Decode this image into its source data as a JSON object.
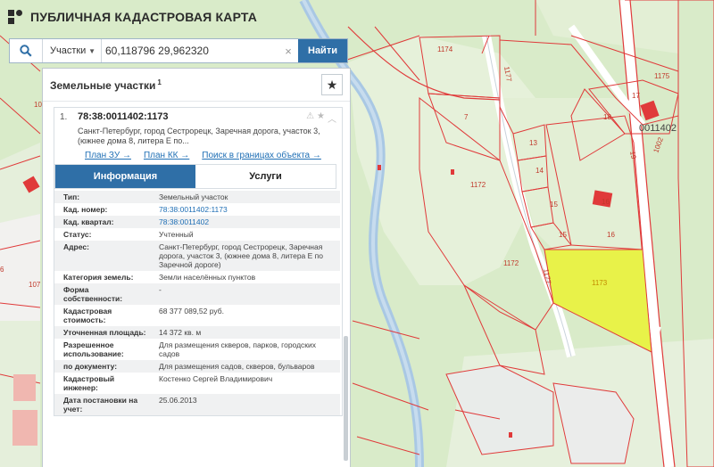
{
  "header": {
    "title": "ПУБЛИЧНАЯ КАДАСТРОВАЯ КАРТА"
  },
  "search": {
    "type_label": "Участки",
    "value": "60,118796 29,962320",
    "find_label": "Найти"
  },
  "panel": {
    "title": "Земельные участки",
    "title_sup": "1"
  },
  "result": {
    "index": "1.",
    "number": "78:38:0011402:1173",
    "address": "Санкт-Петербург, город Сестрорецк, Заречная дорога, участок 3, (южнее дома 8, литера Е по...",
    "links": [
      "План ЗУ →",
      "План КК →",
      "Поиск в границах объекта →"
    ]
  },
  "tabs": {
    "info": "Информация",
    "services": "Услуги"
  },
  "info_rows": [
    {
      "key": "Тип:",
      "value": "Земельный участок"
    },
    {
      "key": "Кад. номер:",
      "value": "78:38:0011402:1173"
    },
    {
      "key": "Кад. квартал:",
      "value": "78:38:0011402"
    },
    {
      "key": "Статус:",
      "value": "Учтенный"
    },
    {
      "key": "Адрес:",
      "value": "Санкт-Петербург, город Сестрорецк, Заречная дорога, участок 3, (южнее дома 8, литера Е по Заречной дороге)"
    },
    {
      "key": "Категория земель:",
      "value": "Земли населённых пунктов"
    },
    {
      "key": "Форма собственности:",
      "value": "-"
    },
    {
      "key": "Кадастровая стоимость:",
      "value": "68 377 089,52 руб."
    },
    {
      "key": "Уточненная площадь:",
      "value": "14 372 кв. м"
    },
    {
      "key": "Разрешенное использование:",
      "value": "Для размещения скверов, парков, городских садов"
    },
    {
      "key": "по документу:",
      "value": "Для размещения садов, скверов, бульваров"
    },
    {
      "key": "Кадастровый инженер:",
      "value": "Костенко Сергей Владимирович"
    },
    {
      "key": "Дата постановки на учет:",
      "value": "25.06.2013"
    }
  ],
  "map": {
    "labels": {
      "l1174": "1174",
      "l1175": "1175",
      "l1177a": "1177",
      "l1177b": "1177",
      "l7": "7",
      "l17": "17",
      "l18": "18",
      "l13": "13",
      "l14": "14",
      "l15a": "15",
      "l15b": "15",
      "l16a": "16",
      "l16b": "16",
      "l1172a": "1172",
      "l1172b": "1172",
      "l1173": "1173",
      "l0011402": "0011402",
      "l19": "19",
      "l1002": "1002",
      "l10": "10",
      "l107": "107",
      "l6": "6"
    },
    "colors": {
      "forest": "#d9ebc9",
      "light_green": "#e9f3dd",
      "river": "#a9c8e4",
      "parcel_border": "#e03a3a",
      "selected_fill": "#e8f249",
      "road": "#ffffff"
    }
  }
}
